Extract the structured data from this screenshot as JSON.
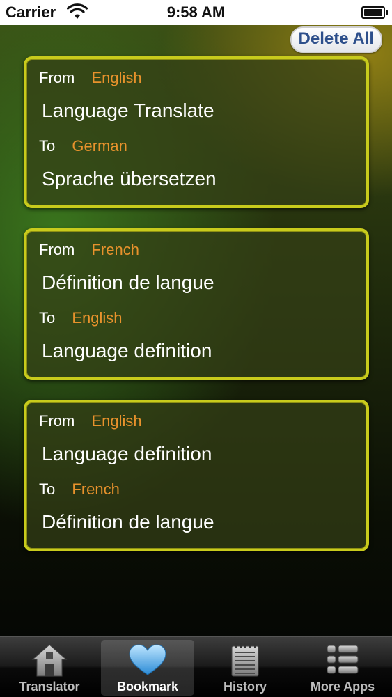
{
  "status": {
    "carrier": "Carrier",
    "time": "9:58 AM"
  },
  "toolbar": {
    "delete_all_label": "Delete All"
  },
  "bookmarks": [
    {
      "from_label": "From",
      "from_lang": "English",
      "source_text": "Language Translate",
      "to_label": "To",
      "to_lang": "German",
      "target_text": "Sprache übersetzen"
    },
    {
      "from_label": "From",
      "from_lang": "French",
      "source_text": "Définition de langue",
      "to_label": "To",
      "to_lang": "English",
      "target_text": "Language definition"
    },
    {
      "from_label": "From",
      "from_lang": "English",
      "source_text": "Language definition",
      "to_label": "To",
      "to_lang": "French",
      "target_text": "Définition de langue"
    }
  ],
  "tabs": [
    {
      "label": "Translator",
      "icon": "house-icon"
    },
    {
      "label": "Bookmark",
      "icon": "heart-icon",
      "active": true
    },
    {
      "label": "History",
      "icon": "notepad-icon"
    },
    {
      "label": "More Apps",
      "icon": "list-icon"
    }
  ],
  "colors": {
    "card_border": "#c8cb1c",
    "language_name": "#e8922c",
    "delete_button_text": "#2d4f8b"
  }
}
